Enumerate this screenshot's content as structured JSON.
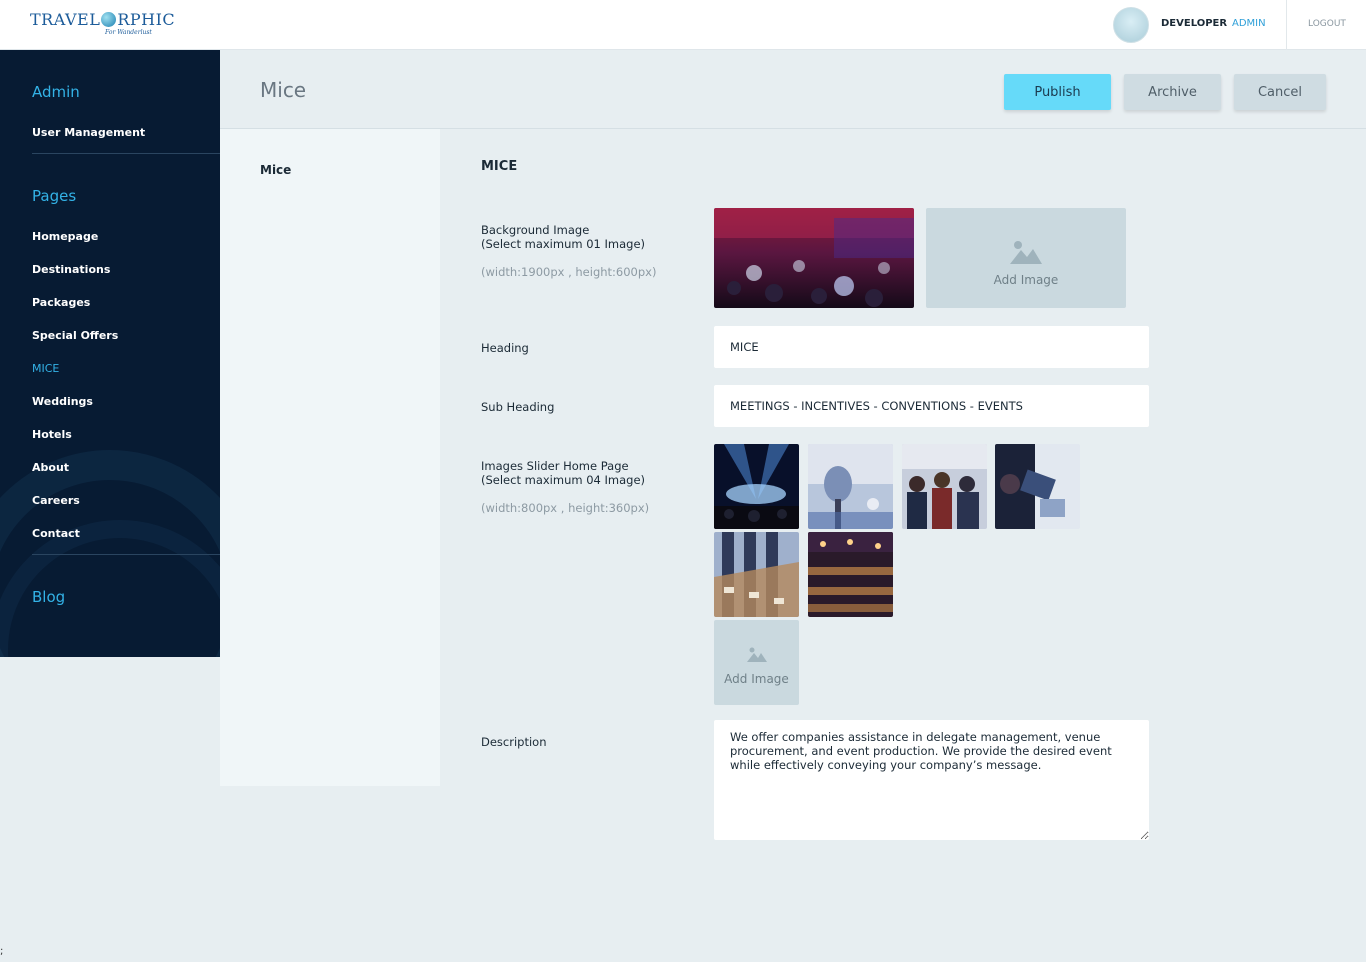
{
  "header": {
    "logo_text_left": "TRAVEL",
    "logo_text_right": "RPHIC",
    "logo_tagline": "For Wanderlust",
    "user_name": "DEVELOPER",
    "user_role": "ADMIN",
    "logout_label": "LOGOUT"
  },
  "sidebar": {
    "admin_heading": "Admin",
    "admin_items": [
      {
        "label": "User Management"
      }
    ],
    "pages_heading": "Pages",
    "pages_items": [
      {
        "label": "Homepage"
      },
      {
        "label": "Destinations"
      },
      {
        "label": "Packages"
      },
      {
        "label": "Special Offers"
      },
      {
        "label": "MICE",
        "active": true
      },
      {
        "label": "Weddings"
      },
      {
        "label": "Hotels"
      },
      {
        "label": "About"
      },
      {
        "label": "Careers"
      },
      {
        "label": "Contact"
      }
    ],
    "blog_heading": "Blog"
  },
  "page": {
    "title": "Mice",
    "publish_label": "Publish",
    "archive_label": "Archive",
    "cancel_label": "Cancel",
    "subnav_item": "Mice"
  },
  "form": {
    "section_title": "MICE",
    "background_image": {
      "label_line1": "Background Image",
      "label_line2": "(Select maximum 01 Image)",
      "hint": "(width:1900px , height:600px)",
      "add_label": "Add Image"
    },
    "heading": {
      "label": "Heading",
      "value": "MICE"
    },
    "sub_heading": {
      "label": "Sub Heading",
      "value": "MEETINGS - INCENTIVES - CONVENTIONS - EVENTS"
    },
    "slider": {
      "label_line1": "Images Slider Home Page",
      "label_line2": "(Select maximum 04 Image)",
      "hint": "(width:800px , height:360px)",
      "add_label": "Add Image"
    },
    "description": {
      "label": "Description",
      "value": "We offer companies assistance in delegate management, venue procurement, and event production. We provide the desired event while effectively conveying your company’s message."
    }
  },
  "footer_mark": ";",
  "colors": {
    "sidebar_bg": "#071b33",
    "accent": "#33b2e6",
    "publish_bg": "#66daf9",
    "secondary_btn_bg": "#cfdce2",
    "page_bg": "#e7eef1"
  }
}
